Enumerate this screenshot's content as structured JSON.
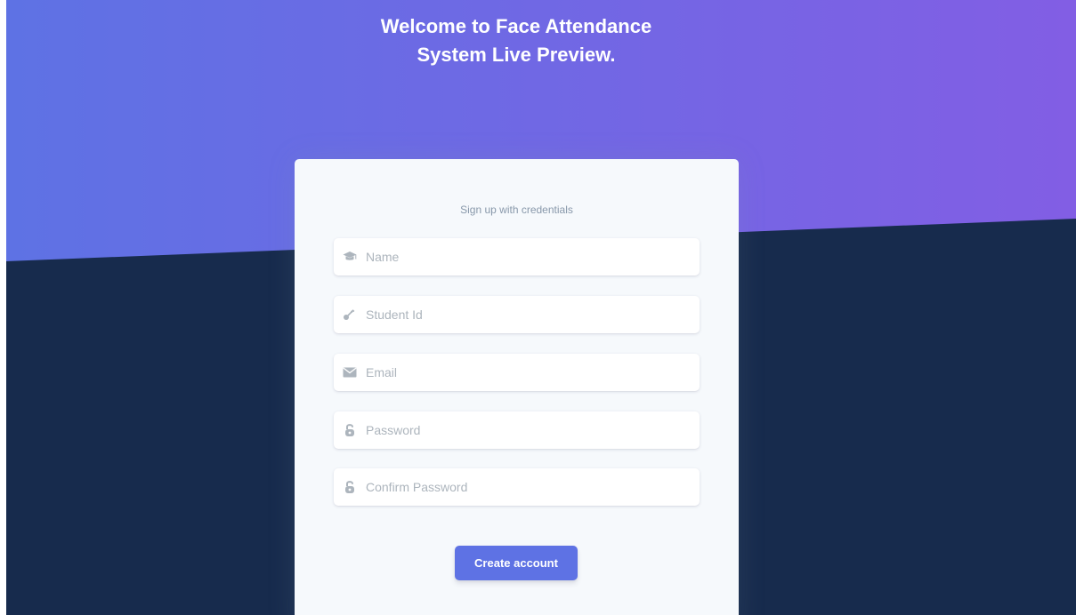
{
  "header": {
    "title_line1": "Welcome to Face Attendance",
    "title_line2": "System Live Preview."
  },
  "form": {
    "subtitle": "Sign up with credentials",
    "fields": [
      {
        "icon": "graduation-cap-icon",
        "placeholder": "Name",
        "value": ""
      },
      {
        "icon": "key-icon",
        "placeholder": "Student Id",
        "value": ""
      },
      {
        "icon": "envelope-icon",
        "placeholder": "Email",
        "value": ""
      },
      {
        "icon": "lock-open-icon",
        "placeholder": "Password",
        "value": ""
      },
      {
        "icon": "lock-open-icon",
        "placeholder": "Confirm Password",
        "value": ""
      }
    ],
    "submit_label": "Create account"
  },
  "colors": {
    "gradient_start": "#5e72e4",
    "gradient_end": "#825ee4",
    "background_dark": "#172b4d",
    "card_background": "#f6f9fc",
    "primary_button": "#5e72e4"
  }
}
